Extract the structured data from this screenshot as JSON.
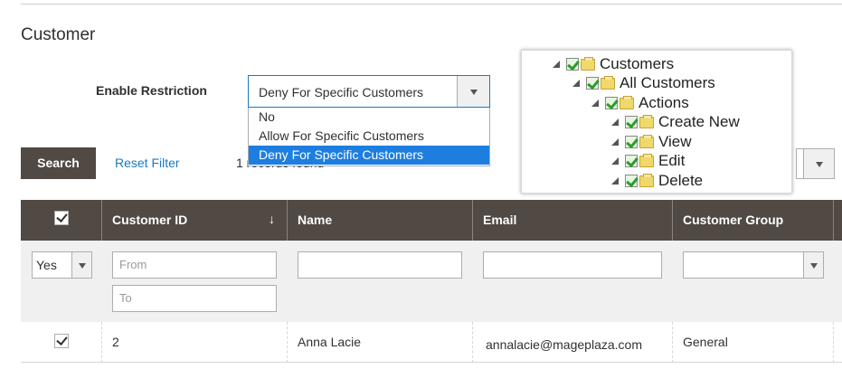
{
  "section": {
    "title": "Customer"
  },
  "restriction": {
    "label": "Enable Restriction",
    "selected": "Deny For Specific Customers",
    "options": [
      "No",
      "Allow For Specific Customers",
      "Deny For Specific Customers"
    ],
    "selected_color": "#1e7ee0"
  },
  "toolbar": {
    "search_label": "Search",
    "reset_label": "Reset Filter",
    "records_text": "1 records found"
  },
  "tree": {
    "items": [
      {
        "label": "Customers",
        "level": 0
      },
      {
        "label": "All Customers",
        "level": 1
      },
      {
        "label": "Actions",
        "level": 2
      },
      {
        "label": "Create New",
        "level": 3
      },
      {
        "label": "View",
        "level": 3
      },
      {
        "label": "Edit",
        "level": 3
      },
      {
        "label": "Delete",
        "level": 3
      }
    ],
    "arrow_color": "#1aa08a"
  },
  "grid": {
    "header_color": "#514943",
    "columns": [
      "Customer ID",
      "Name",
      "Email",
      "Customer Group"
    ],
    "filters": {
      "select_value": "Yes",
      "from_placeholder": "From",
      "to_placeholder": "To"
    },
    "rows": [
      {
        "checked": true,
        "id": "2",
        "name": "Anna Lacie",
        "email": "annalacie@mageplaza.com",
        "group": "General"
      }
    ]
  }
}
